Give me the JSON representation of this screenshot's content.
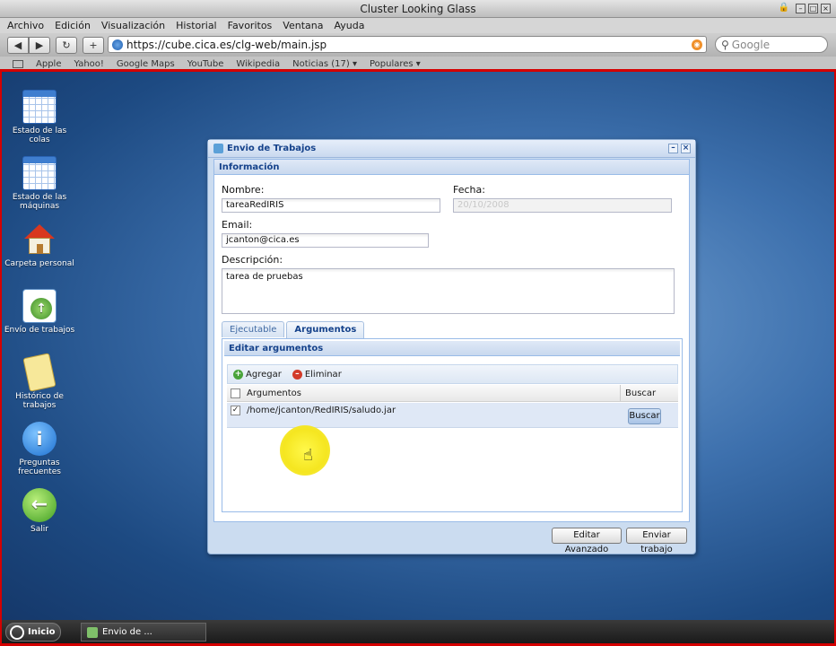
{
  "browser": {
    "window_title": "Cluster Looking Glass",
    "menu": [
      "Archivo",
      "Edición",
      "Visualización",
      "Historial",
      "Favoritos",
      "Ventana",
      "Ayuda"
    ],
    "url": "https://cube.cica.es/clg-web/main.jsp",
    "search_placeholder": "Google",
    "bookmarks": [
      "Apple",
      "Yahoo!",
      "Google Maps",
      "YouTube",
      "Wikipedia",
      "Noticias (17) ▾",
      "Populares ▾"
    ]
  },
  "desktop": {
    "icons": [
      {
        "label": "Estado de las colas"
      },
      {
        "label": "Estado de las máquinas"
      },
      {
        "label": "Carpeta personal"
      },
      {
        "label": "Envío de trabajos"
      },
      {
        "label": "Histórico de trabajos"
      },
      {
        "label": "Preguntas frecuentes"
      },
      {
        "label": "Salir"
      }
    ]
  },
  "dialog": {
    "title": "Envio de Trabajos",
    "section_title": "Información",
    "nombre_label": "Nombre:",
    "nombre_value": "tareaRedIRIS",
    "fecha_label": "Fecha:",
    "fecha_value": "20/10/2008",
    "email_label": "Email:",
    "email_value": "jcanton@cica.es",
    "descripcion_label": "Descripción:",
    "descripcion_value": "tarea de pruebas",
    "tabs": [
      "Ejecutable",
      "Argumentos"
    ],
    "panel_title": "Editar argumentos",
    "agregar_label": "Agregar",
    "eliminar_label": "Eliminar",
    "grid_headers": [
      "Argumentos",
      "Buscar"
    ],
    "rows": [
      {
        "value": "/home/jcanton/RedIRIS/saludo.jar",
        "button": "Buscar",
        "checked": true
      }
    ],
    "btn_advanced": "Editar Avanzado",
    "btn_send": "Enviar trabajo"
  },
  "taskbar": {
    "start_label": "Inicio",
    "task_item": "Envio de ..."
  }
}
